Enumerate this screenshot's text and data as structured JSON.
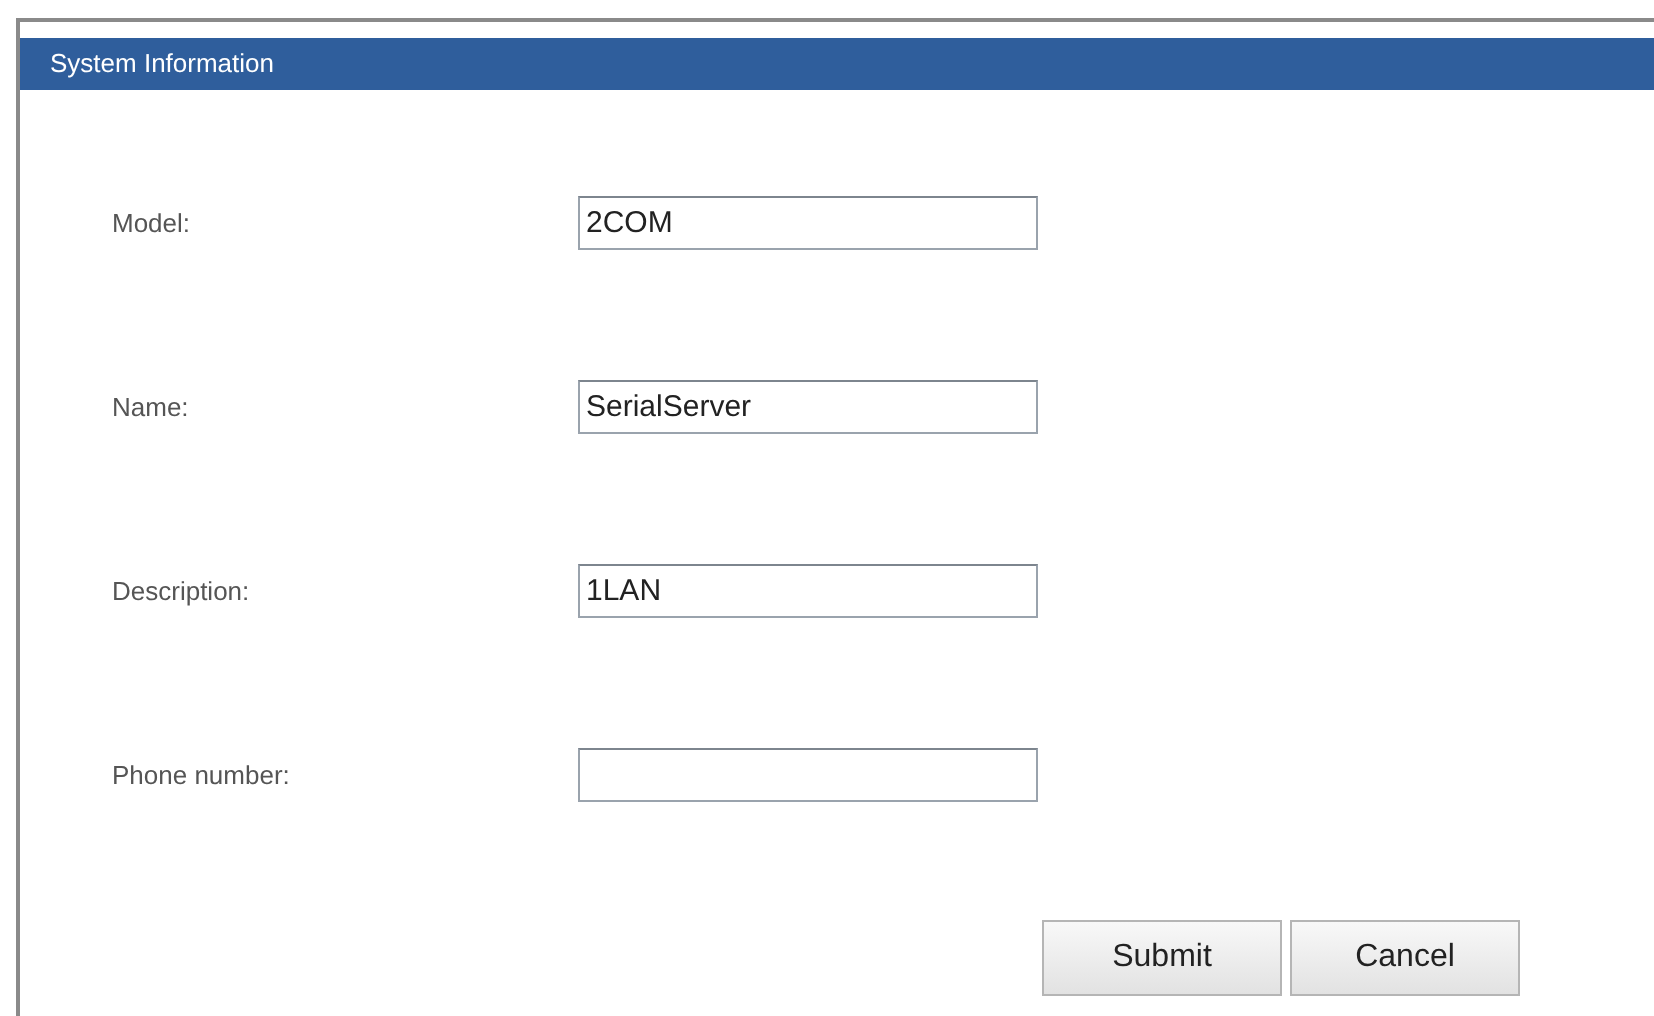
{
  "panel": {
    "title": "System Information"
  },
  "fields": [
    {
      "label": "Model:",
      "value": "2COM"
    },
    {
      "label": "Name:",
      "value": "SerialServer"
    },
    {
      "label": "Description:",
      "value": "1LAN"
    },
    {
      "label": "Phone number:"
    }
  ],
  "buttons": [
    "Submit",
    "Cancel"
  ]
}
